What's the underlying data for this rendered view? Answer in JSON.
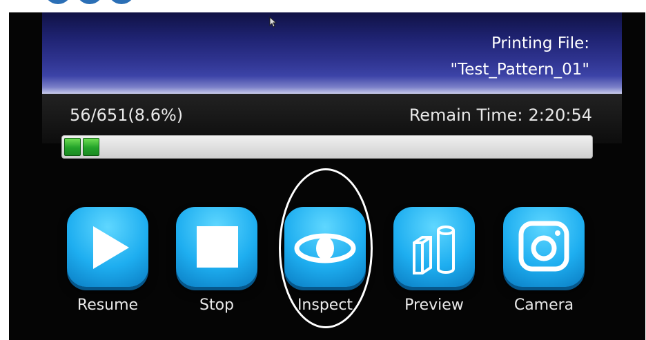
{
  "header": {
    "title_line1": "Printing File:",
    "title_line2": "\"Test_Pattern_01\""
  },
  "status": {
    "progress_text": "56/651(8.6%)",
    "remain_label": "Remain Time:",
    "remain_value": "2:20:54",
    "progress_fraction": 0.086,
    "visible_segments": 2
  },
  "buttons": [
    {
      "label": "Resume",
      "icon": "play-icon"
    },
    {
      "label": "Stop",
      "icon": "stop-icon"
    },
    {
      "label": "Inspect",
      "icon": "eye-icon"
    },
    {
      "label": "Preview",
      "icon": "shapes-icon"
    },
    {
      "label": "Camera",
      "icon": "camera-icon"
    }
  ],
  "colors": {
    "button_tile": "#1eaef0",
    "header": "#2e338f",
    "progress_fill": "#23a32a",
    "highlight": "#ffffff"
  }
}
